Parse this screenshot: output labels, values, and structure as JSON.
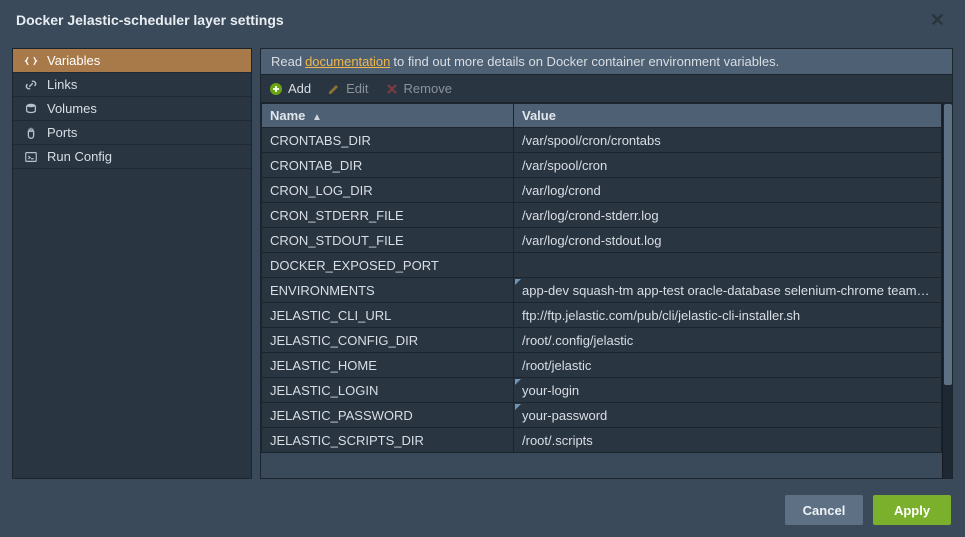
{
  "title": "Docker Jelastic-scheduler layer settings",
  "sidebar": {
    "items": [
      {
        "label": "Variables"
      },
      {
        "label": "Links"
      },
      {
        "label": "Volumes"
      },
      {
        "label": "Ports"
      },
      {
        "label": "Run Config"
      }
    ]
  },
  "info": {
    "prefix": "Read",
    "link": "documentation",
    "suffix": "to find out more details on Docker container environment variables."
  },
  "toolbar": {
    "add": "Add",
    "edit": "Edit",
    "remove": "Remove"
  },
  "columns": {
    "name": "Name",
    "value": "Value"
  },
  "rows": [
    {
      "name": "CRONTABS_DIR",
      "value": "/var/spool/cron/crontabs",
      "mark": false
    },
    {
      "name": "CRONTAB_DIR",
      "value": "/var/spool/cron",
      "mark": false
    },
    {
      "name": "CRON_LOG_DIR",
      "value": "/var/log/crond",
      "mark": false
    },
    {
      "name": "CRON_STDERR_FILE",
      "value": "/var/log/crond-stderr.log",
      "mark": false
    },
    {
      "name": "CRON_STDOUT_FILE",
      "value": "/var/log/crond-stdout.log",
      "mark": false
    },
    {
      "name": "DOCKER_EXPOSED_PORT",
      "value": "",
      "mark": false
    },
    {
      "name": "ENVIRONMENTS",
      "value": "app-dev squash-tm app-test oracle-database selenium-chrome teamcity",
      "mark": true
    },
    {
      "name": "JELASTIC_CLI_URL",
      "value": "ftp://ftp.jelastic.com/pub/cli/jelastic-cli-installer.sh",
      "mark": false
    },
    {
      "name": "JELASTIC_CONFIG_DIR",
      "value": "/root/.config/jelastic",
      "mark": false
    },
    {
      "name": "JELASTIC_HOME",
      "value": "/root/jelastic",
      "mark": false
    },
    {
      "name": "JELASTIC_LOGIN",
      "value": "your-login",
      "mark": true
    },
    {
      "name": "JELASTIC_PASSWORD",
      "value": "your-password",
      "mark": true
    },
    {
      "name": "JELASTIC_SCRIPTS_DIR",
      "value": "/root/.scripts",
      "mark": false
    }
  ],
  "footer": {
    "cancel": "Cancel",
    "apply": "Apply"
  }
}
